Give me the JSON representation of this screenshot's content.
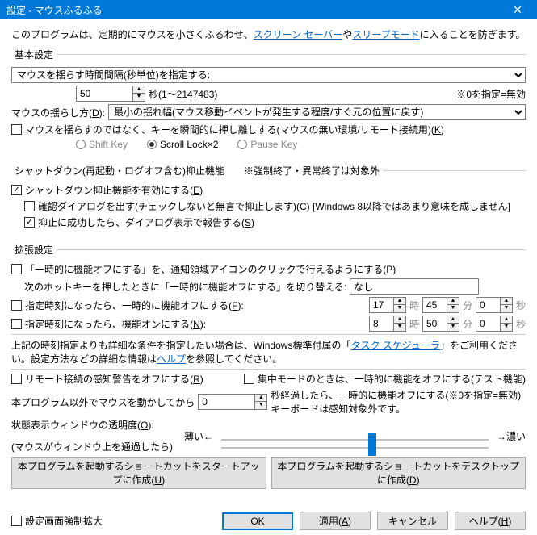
{
  "titlebar": {
    "title": "設定 - マウスふるふる"
  },
  "intro": {
    "p1": "このプログラムは、定期的にマウスを小さくふるわせ、",
    "link1": "スクリーン セーバー",
    "p2": "や",
    "link2": "スリープモード",
    "p3": "に入ることを防ぎます。"
  },
  "basic": {
    "legend": "基本設定",
    "interval_label": "マウスを揺らす時間間隔(秒単位)を指定する:",
    "interval_value": "50",
    "interval_unit": "秒(1～2147483)",
    "interval_note": "※0を指定=無効",
    "shake_label": "マウスの揺らし方(",
    "shake_label2": "):",
    "shake_accel": "D",
    "shake_select": "最小の揺れ幅(マウス移動イベントが発生する程度/すぐ元の位置に戻す)",
    "chk_keypress": "マウスを揺らすのではなく、キーを瞬間的に押し離しする(マウスの無い環境/リモート接続用)(",
    "chk_keypress_accel": "K",
    "radio1": "Shift Key",
    "radio2": "Scroll Lock×2",
    "radio3": "Pause Key"
  },
  "shutdown": {
    "legend": "シャットダウン(再起動・ログオフ含む)抑止機能　　※強制終了・異常終了は対象外",
    "chk_enable": "シャットダウン抑止機能を有効にする(",
    "chk_enable_accel": "E",
    "chk_confirm": "確認ダイアログを出す(チェックしないと無言で抑止します)(",
    "chk_confirm_accel": "C",
    "chk_confirm_suffix": ") [Windows 8以降ではあまり意味を成しません]",
    "chk_report": "抑止に成功したら、ダイアログ表示で報告する(",
    "chk_report_accel": "S"
  },
  "ext": {
    "legend": "拡張設定",
    "chk_tray": "「一時的に機能オフにする」を、通知領域アイコンのクリックで行えるようにする(",
    "chk_tray_accel": "P",
    "hotkey_label": "次のホットキーを押したときに「一時的に機能オフにする」を切り替える:",
    "hotkey_value": "なし",
    "chk_off_at": "指定時刻になったら、一時的に機能オフにする(",
    "chk_off_at_accel": "F",
    "off_h": "17",
    "off_m": "45",
    "off_s": "0",
    "chk_on_at": "指定時刻になったら、機能オンにする(",
    "chk_on_at_accel": "N",
    "on_h": "8",
    "on_m": "50",
    "on_s": "0",
    "time_h": "時",
    "time_m": "分",
    "time_s": "秒",
    "sched_note1": "上記の時刻指定よりも詳細な条件を指定したい場合は、Windows標準付属の「",
    "sched_link": "タスク スケジューラ",
    "sched_note2": "」をご利用ください。設定方法などの詳細な情報は",
    "sched_link2": "ヘルプ",
    "sched_note3": "を参照してください。",
    "chk_remote": "リモート接続の感知警告をオフにする(",
    "chk_remote_accel": "R",
    "chk_focus": "集中モードのときは、一時的に機能をオフにする(テスト機能)",
    "idle_label": "本プログラム以外でマウスを動かしてから",
    "idle_value": "0",
    "idle_suffix1": "秒経過したら、一時的に機能オフにする(※0を指定=無効)",
    "idle_suffix2": "キーボードは感知対象外です。",
    "trans_label": "状態表示ウィンドウの透明度(",
    "trans_accel": "O",
    "trans_sub": "(マウスがウィンドウ上を通過したら)",
    "trans_light": "薄い←",
    "trans_dark": "→濃い",
    "btn_startup": "本プログラムを起動するショートカットをスタートアップに作成(",
    "btn_startup_accel": "U",
    "btn_desktop": "本プログラムを起動するショートカットをデスクトップに作成(",
    "btn_desktop_accel": "D"
  },
  "footer": {
    "chk_force": "設定画面強制拡大",
    "ok": "OK",
    "apply": "適用(",
    "apply_accel": "A",
    "cancel": "キャンセル",
    "help": "ヘルプ(",
    "help_accel": "H"
  }
}
